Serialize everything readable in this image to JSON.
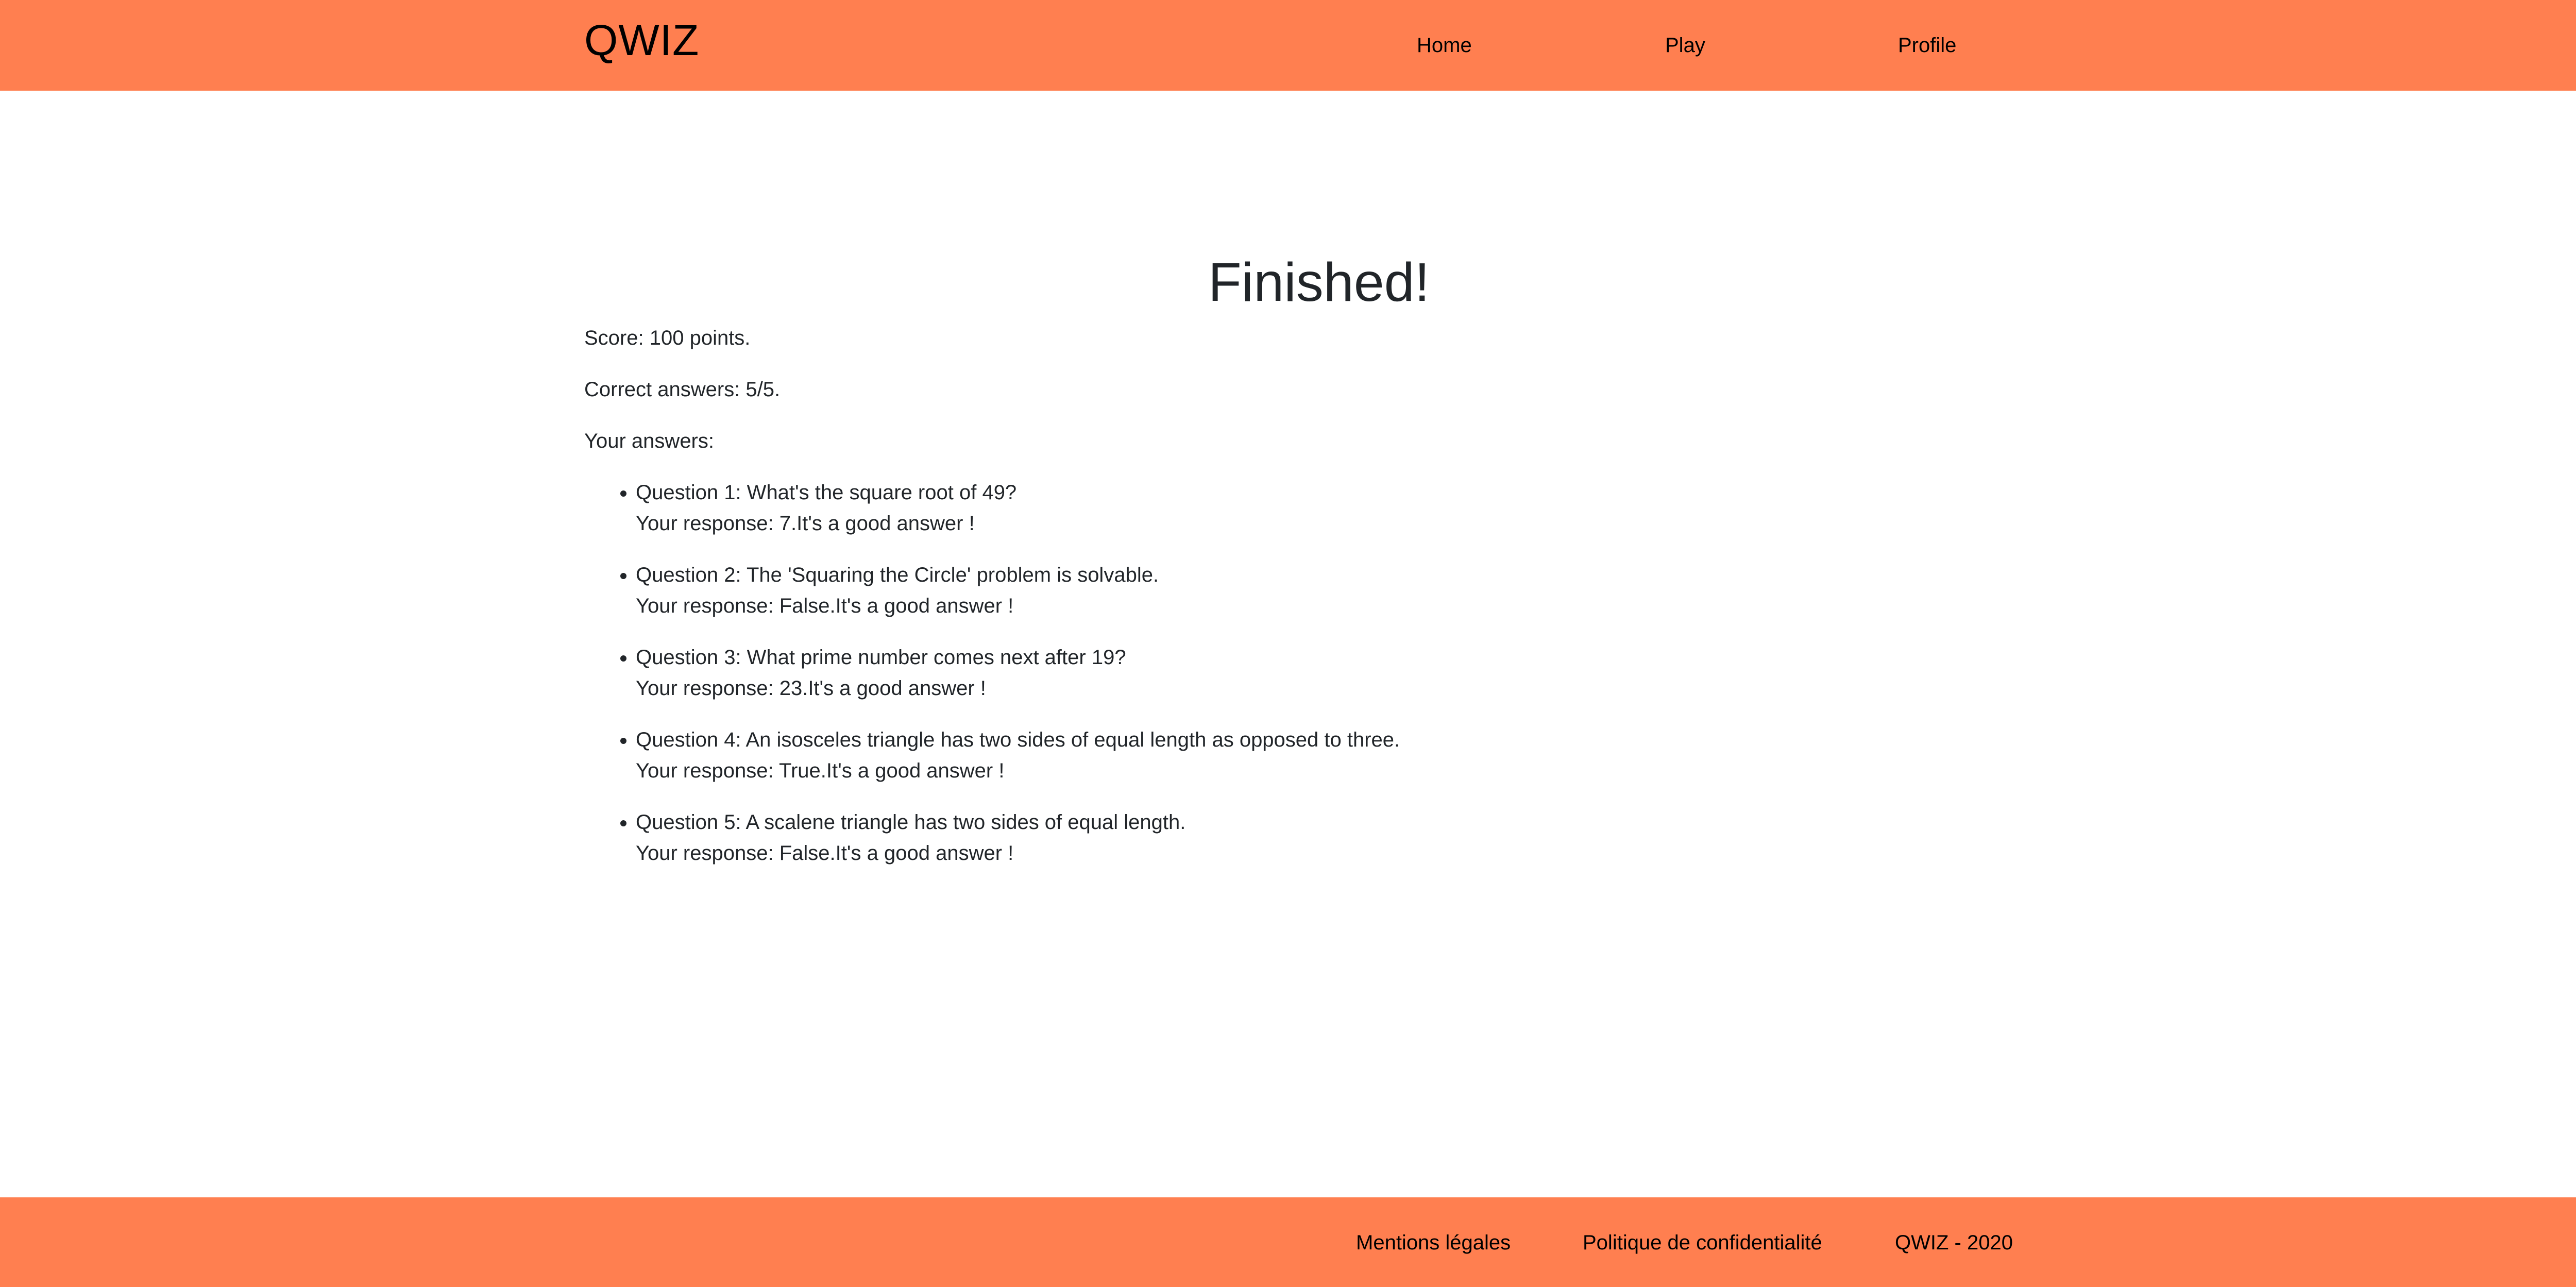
{
  "header": {
    "logo": "QWIZ",
    "nav": {
      "home": "Home",
      "play": "Play",
      "profile": "Profile"
    }
  },
  "main": {
    "title": "Finished!",
    "score": "Score: 100 points.",
    "correct": "Correct answers: 5/5.",
    "answers_label": "Your answers:",
    "answers": [
      {
        "question": "Question 1: What's the square root of 49?",
        "response": "Your response: 7.It's a good answer !"
      },
      {
        "question": "Question 2: The 'Squaring the Circle' problem is solvable.",
        "response": "Your response: False.It's a good answer !"
      },
      {
        "question": "Question 3: What prime number comes next after 19?",
        "response": "Your response: 23.It's a good answer !"
      },
      {
        "question": "Question 4: An isosceles triangle has two sides of equal length as opposed to three.",
        "response": "Your response: True.It's a good answer !"
      },
      {
        "question": "Question 5: A scalene triangle has two sides of equal length.",
        "response": "Your response: False.It's a good answer !"
      }
    ]
  },
  "footer": {
    "legal": "Mentions légales",
    "privacy": "Politique de confidentialité",
    "copyright": "QWIZ - 2020"
  },
  "colors": {
    "brand": "#ff7f50",
    "text": "#212529"
  }
}
